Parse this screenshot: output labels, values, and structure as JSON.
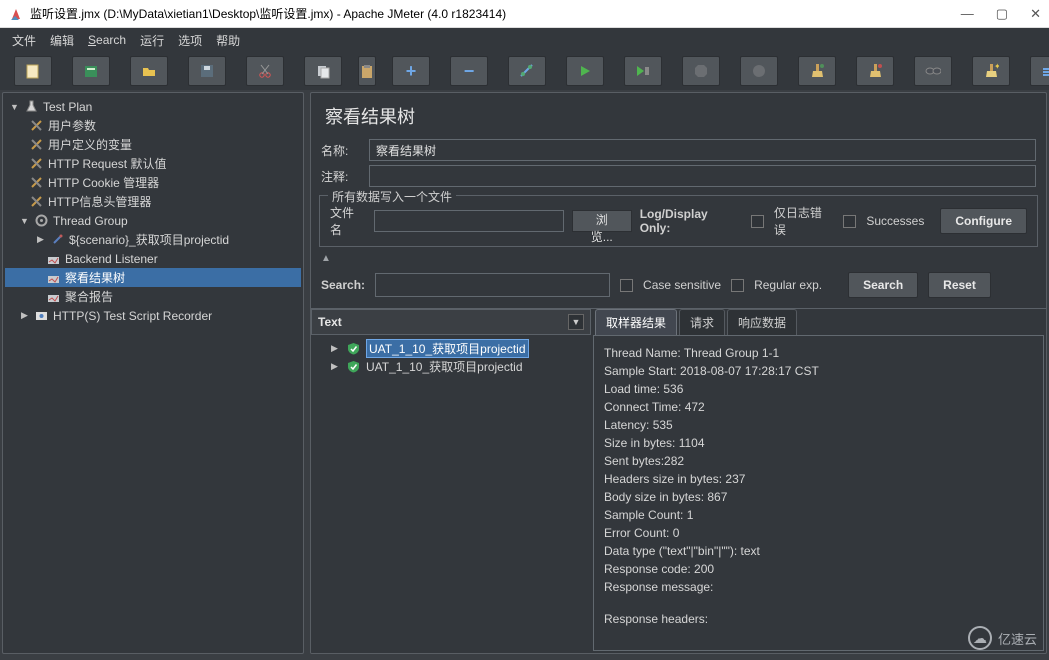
{
  "titlebar": {
    "title": "监听设置.jmx (D:\\MyData\\xietian1\\Desktop\\监听设置.jmx) - Apache JMeter (4.0 r1823414)"
  },
  "menu": {
    "file": "文件",
    "edit": "编辑",
    "search": "Search",
    "run": "运行",
    "options": "选项",
    "help": "帮助"
  },
  "tree": {
    "root": "Test Plan",
    "items": [
      "用户参数",
      "用户定义的变量",
      "HTTP Request 默认值",
      "HTTP Cookie 管理器",
      "HTTP信息头管理器"
    ],
    "thread_group": "Thread Group",
    "tg_items": [
      "${scenario}_获取项目projectid",
      "Backend Listener",
      "察看结果树",
      "聚合报告"
    ],
    "recorder": "HTTP(S) Test Script Recorder"
  },
  "main": {
    "title": "察看结果树",
    "name_label": "名称:",
    "name_value": "察看结果树",
    "comment_label": "注释:",
    "comment_value": "",
    "write_group": "所有数据写入一个文件",
    "filename_label": "文件名",
    "filename_value": "",
    "browse": "浏览...",
    "log_display": "Log/Display Only:",
    "errors_only": "仅日志错误",
    "successes": "Successes",
    "configure": "Configure",
    "search_label": "Search:",
    "case_sensitive": "Case sensitive",
    "regexp": "Regular exp.",
    "search_btn": "Search",
    "reset_btn": "Reset",
    "result_type": "Text"
  },
  "results": {
    "items": [
      "UAT_1_10_获取项目projectid",
      "UAT_1_10_获取项目projectid"
    ],
    "selected_index": 0
  },
  "tabs": {
    "sampler": "取样器结果",
    "request": "请求",
    "response": "响应数据"
  },
  "details": {
    "thread_name": "Thread Name: Thread Group 1-1",
    "sample_start": "Sample Start: 2018-08-07 17:28:17 CST",
    "load_time": "Load time: 536",
    "connect_time": "Connect Time: 472",
    "latency": "Latency: 535",
    "size_bytes": "Size in bytes: 1104",
    "sent_bytes": "Sent bytes:282",
    "headers_size": "Headers size in bytes: 237",
    "body_size": "Body size in bytes: 867",
    "sample_count": "Sample Count: 1",
    "error_count": "Error Count: 0",
    "data_type": "Data type (\"text\"|\"bin\"|\"\"): text",
    "response_code": "Response code: 200",
    "response_message": "Response message:",
    "response_headers": "Response headers:"
  },
  "watermark": "亿速云"
}
